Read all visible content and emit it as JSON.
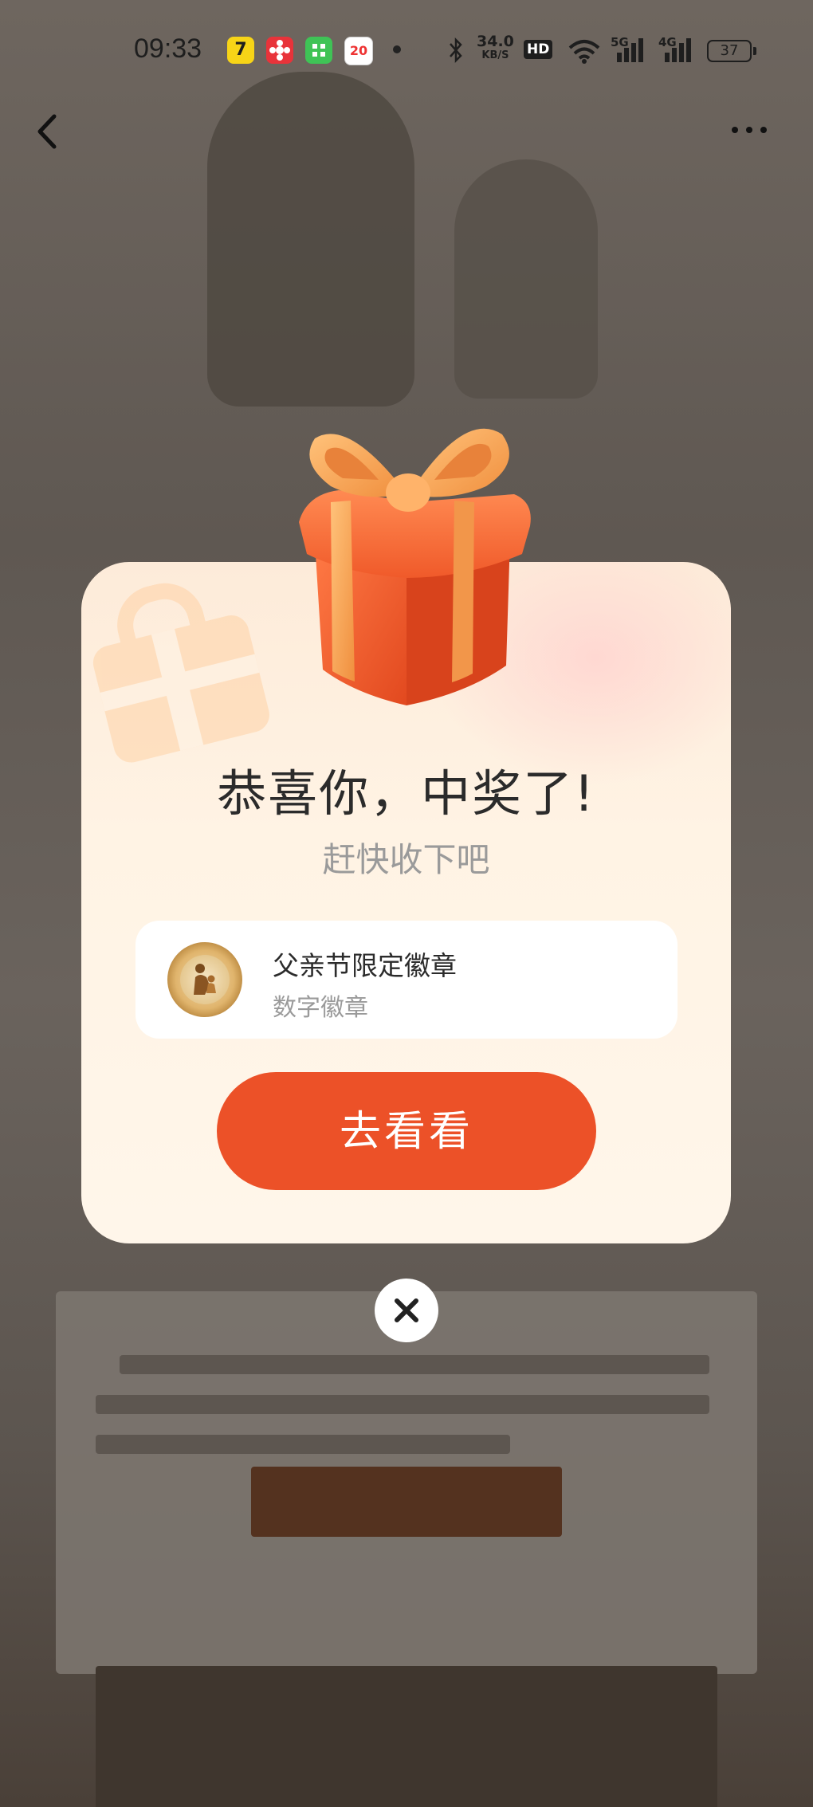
{
  "status_bar": {
    "time": "09:33",
    "notification_icons": [
      "7",
      "flower-icon",
      "chat-icon",
      "20"
    ],
    "net_speed_value": "34.0",
    "net_speed_unit": "KB/S",
    "hd_label": "HD",
    "signal_5g_label": "5G",
    "signal_4g_label": "4G",
    "battery": "37"
  },
  "nav": {
    "back_icon": "chevron-left-icon",
    "more_icon": "more-horizontal-icon"
  },
  "modal": {
    "title": "恭喜你，中奖了!",
    "subtitle": "赶快收下吧",
    "prize": {
      "name": "父亲节限定徽章",
      "type": "数字徽章",
      "icon": "medal-icon"
    },
    "cta_label": "去看看",
    "close_icon": "close-icon"
  },
  "colors": {
    "accent": "#ec5128",
    "gift": "#f0622f",
    "ribbon": "#f4a055"
  }
}
